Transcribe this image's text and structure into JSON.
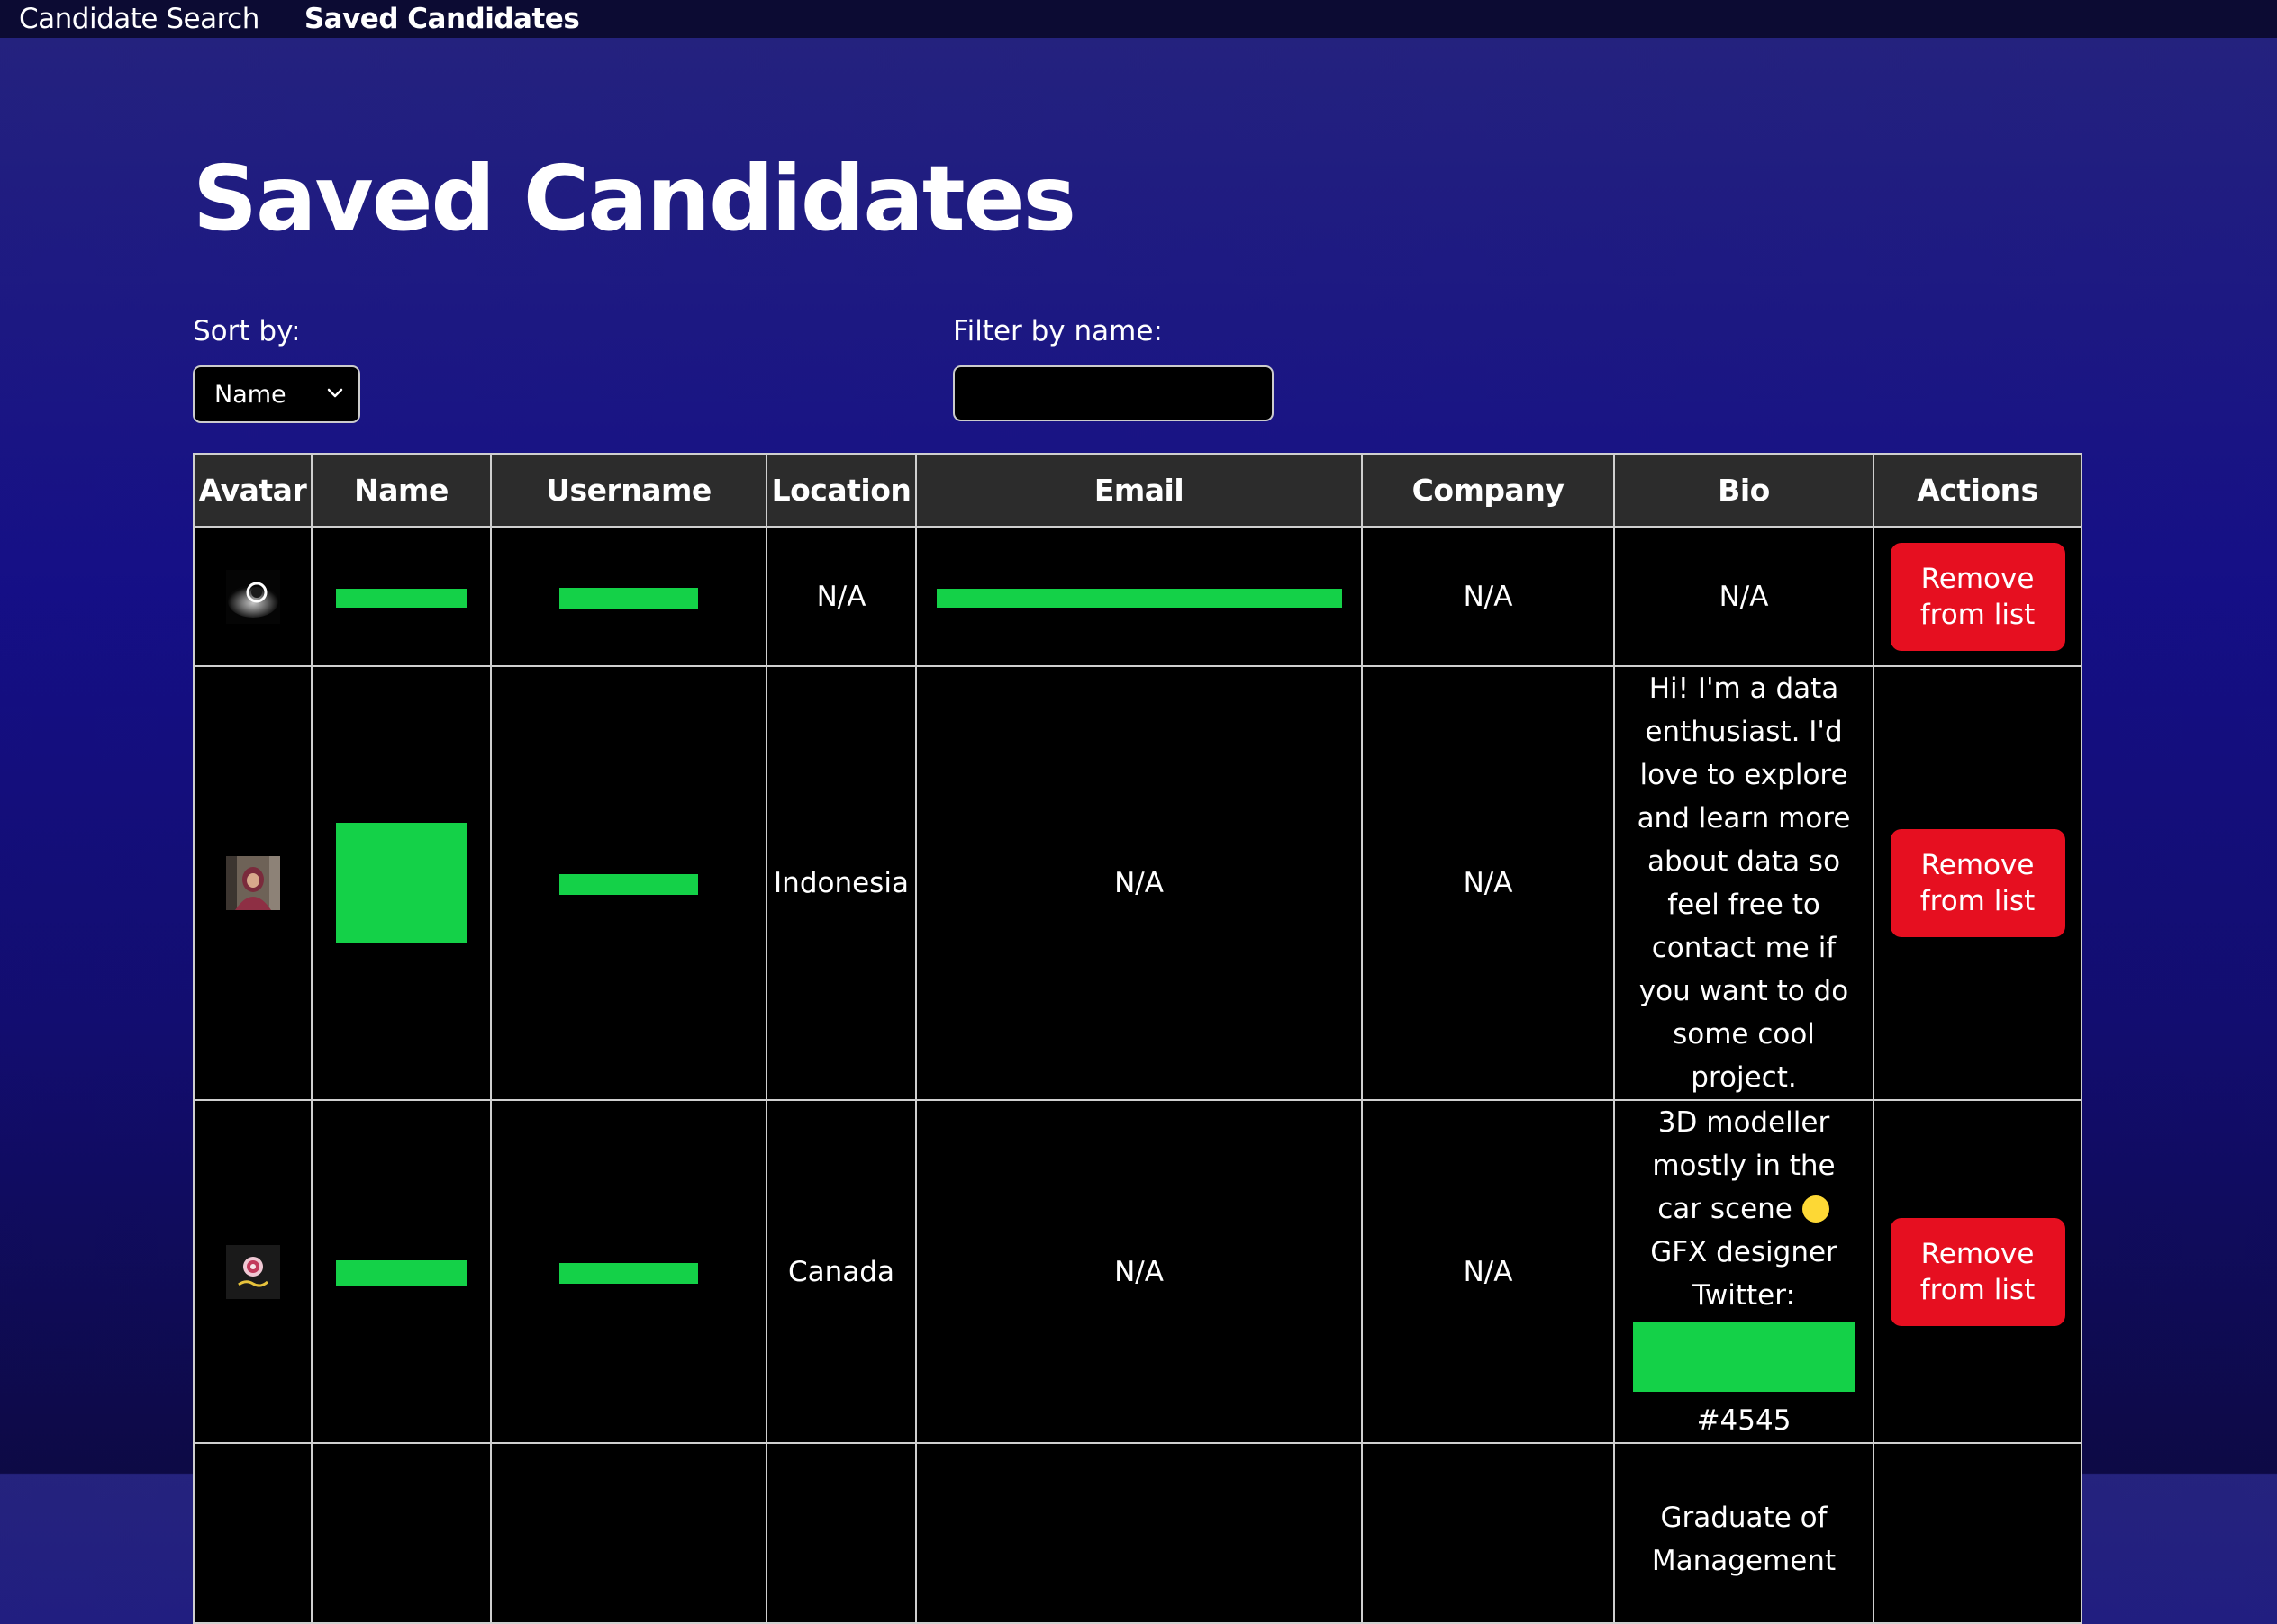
{
  "nav": {
    "links": [
      {
        "label": "Candidate Search"
      },
      {
        "label": "Saved Candidates"
      }
    ]
  },
  "page": {
    "title": "Saved Candidates"
  },
  "controls": {
    "sort_label": "Sort by:",
    "sort_value": "Name",
    "filter_label": "Filter by name:",
    "filter_value": ""
  },
  "table": {
    "headers": [
      "Avatar",
      "Name",
      "Username",
      "Location",
      "Email",
      "Company",
      "Bio",
      "Actions"
    ],
    "rows": [
      {
        "avatar": "avatar-image",
        "name": "",
        "username": "",
        "location": "N/A",
        "email": "",
        "company": "N/A",
        "bio": "N/A",
        "action": "Remove from list"
      },
      {
        "avatar": "avatar-image",
        "name": "",
        "username": "",
        "location": "Indonesia",
        "email": "N/A",
        "company": "N/A",
        "bio": "Hi! I'm a data enthusiast. I'd love to explore and learn more about data so feel free to contact me if you want to do some cool project.",
        "action": "Remove from list"
      },
      {
        "avatar": "avatar-image",
        "name": "",
        "username": "",
        "location": "Canada",
        "email": "N/A",
        "company": "N/A",
        "bio_before": "3D modeller mostly in the car scene",
        "bio_emoji": "yellow-circle",
        "bio_mid": "GFX designer Twitter:",
        "bio_after": "#4545",
        "action": "Remove from list"
      },
      {
        "avatar": "",
        "name": "",
        "username": "",
        "location": "",
        "email": "",
        "company": "",
        "bio": "Graduate of Management",
        "action": ""
      }
    ]
  },
  "colors": {
    "redaction": "#14d148",
    "remove_button": "#e60f20",
    "header_bg": "#2c2c2c",
    "nav_bg": "#0c0b33",
    "page_bg": "#150f86"
  }
}
